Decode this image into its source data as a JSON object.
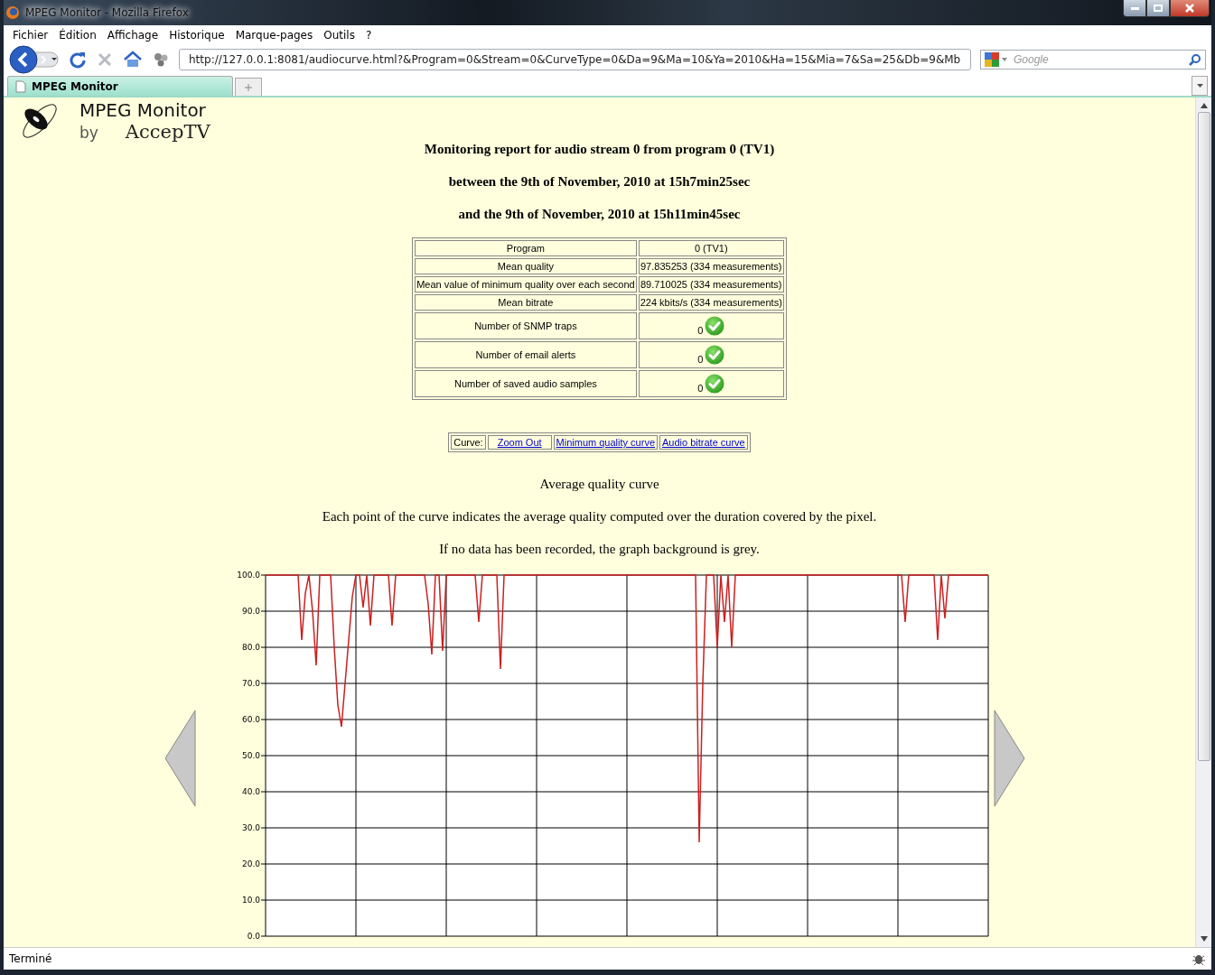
{
  "window": {
    "title": "MPEG Monitor - Mozilla Firefox"
  },
  "menu": [
    "Fichier",
    "Édition",
    "Affichage",
    "Historique",
    "Marque-pages",
    "Outils",
    "?"
  ],
  "toolbar": {
    "url": "http://127.0.0.1:8081/audiocurve.html?&Program=0&Stream=0&CurveType=0&Da=9&Ma=10&Ya=2010&Ha=15&Mia=7&Sa=25&Db=9&Mb",
    "search": {
      "placeholder": "Google"
    }
  },
  "tabs": [
    {
      "label": "MPEG Monitor",
      "selected": true
    }
  ],
  "page": {
    "logo": {
      "title": "MPEG Monitor",
      "by": "by",
      "brand": "AccepTV"
    },
    "headings": [
      "Monitoring report for audio stream 0 from program 0 (TV1)",
      "between the 9th of November, 2010 at 15h7min25sec",
      "and the 9th of November, 2010 at 15h11min45sec"
    ],
    "summary": [
      {
        "label": "Program",
        "value": "0 (TV1)",
        "kind": "text"
      },
      {
        "label": "Mean quality",
        "value": "97.835253 (334 measurements)",
        "kind": "text"
      },
      {
        "label": "Mean value of minimum quality over each second",
        "value": "89.710025 (334 measurements)",
        "kind": "text"
      },
      {
        "label": "Mean bitrate",
        "value": "224 kbits/s (334 measurements)",
        "kind": "text"
      },
      {
        "label": "Number of SNMP traps",
        "value": "0",
        "kind": "ok"
      },
      {
        "label": "Number of email alerts",
        "value": "0",
        "kind": "ok"
      },
      {
        "label": "Number of saved audio samples",
        "value": "0",
        "kind": "ok"
      }
    ],
    "curve_nav": {
      "label": "Curve:",
      "links": [
        "Zoom Out",
        "Minimum quality curve",
        "Audio bitrate curve"
      ]
    },
    "paragraphs": [
      "Average quality curve",
      "Each point of the curve indicates the average quality computed over the duration covered by the pixel.",
      "If no data has been recorded, the graph background is grey."
    ],
    "chart_data": {
      "type": "line",
      "grid": true,
      "ylim": [
        0,
        100
      ],
      "yticks": [
        {
          "value": 100,
          "label": "100.0"
        },
        {
          "value": 90,
          "label": "90.0"
        },
        {
          "value": 80,
          "label": "80.0"
        },
        {
          "value": 70,
          "label": "70.0"
        },
        {
          "value": 60,
          "label": "60.0"
        },
        {
          "value": 50,
          "label": "50.0"
        },
        {
          "value": 40,
          "label": "40.0"
        },
        {
          "value": 30,
          "label": "30.0"
        },
        {
          "value": 20,
          "label": "20.0"
        },
        {
          "value": 10,
          "label": "10.0"
        },
        {
          "value": 0,
          "label": "0.0"
        }
      ],
      "categories": [
        null,
        null,
        null,
        null,
        null,
        null,
        null,
        null,
        null,
        null,
        null,
        null,
        null,
        null,
        null,
        null,
        null,
        null,
        null,
        null,
        null,
        null,
        null,
        null,
        null,
        null,
        null,
        null,
        null,
        null,
        null,
        null,
        null,
        null,
        null,
        null,
        null,
        null,
        null,
        null,
        null,
        null,
        null,
        null,
        null,
        null,
        null,
        null,
        null,
        null,
        null,
        null,
        null,
        null,
        null,
        null,
        null,
        null,
        null,
        null,
        null,
        null,
        null,
        null,
        null,
        null,
        null,
        null,
        null,
        null,
        null,
        null,
        null,
        null,
        null,
        null,
        null,
        null,
        null,
        null,
        null,
        null,
        null,
        null,
        null,
        null,
        null,
        null,
        null,
        null,
        null,
        null,
        null,
        null,
        null,
        null,
        null,
        null,
        null,
        null,
        null,
        null,
        null,
        null,
        null,
        null,
        null,
        null,
        null,
        null,
        null,
        null,
        null,
        null,
        null,
        null,
        null,
        null,
        null,
        null,
        null,
        null,
        null,
        null,
        null,
        null,
        null,
        null,
        null,
        null,
        null,
        null,
        null,
        null,
        null,
        null,
        null,
        null,
        null,
        null,
        null,
        null,
        null,
        null,
        null,
        null,
        null,
        null,
        null,
        null,
        null,
        null,
        null,
        null,
        null,
        null,
        null,
        null,
        null,
        null,
        null,
        null,
        null,
        null,
        null,
        null,
        null,
        null,
        null,
        null,
        null,
        null,
        null,
        null,
        null,
        null,
        null,
        null,
        null,
        null,
        null,
        null,
        null,
        null,
        null,
        null,
        null,
        null,
        null,
        null,
        null,
        null,
        null,
        null,
        null,
        null,
        null,
        null,
        null,
        null,
        null
      ],
      "series": [
        {
          "color": "#cc1f1f",
          "values": [
            100,
            100,
            100,
            100,
            100,
            100,
            100,
            100,
            100,
            100,
            82,
            95,
            100,
            90,
            75,
            100,
            100,
            100,
            100,
            80,
            64,
            58,
            70,
            82,
            94,
            100,
            100,
            91,
            100,
            86,
            100,
            100,
            100,
            100,
            100,
            86,
            100,
            100,
            100,
            100,
            100,
            100,
            100,
            100,
            100,
            92,
            78,
            100,
            100,
            79,
            100,
            100,
            100,
            100,
            100,
            100,
            100,
            100,
            100,
            87,
            100,
            100,
            100,
            100,
            100,
            74,
            100,
            100,
            100,
            100,
            100,
            100,
            100,
            100,
            100,
            100,
            100,
            100,
            100,
            100,
            100,
            100,
            100,
            100,
            100,
            100,
            100,
            100,
            100,
            100,
            100,
            100,
            100,
            100,
            100,
            100,
            100,
            100,
            100,
            100,
            100,
            100,
            100,
            100,
            100,
            100,
            100,
            100,
            100,
            100,
            100,
            100,
            100,
            100,
            100,
            100,
            100,
            100,
            100,
            100,
            26,
            70,
            100,
            100,
            100,
            80,
            100,
            87,
            100,
            80,
            100,
            100,
            100,
            100,
            100,
            100,
            100,
            100,
            100,
            100,
            100,
            100,
            100,
            100,
            100,
            100,
            100,
            100,
            100,
            100,
            100,
            100,
            100,
            100,
            100,
            100,
            100,
            100,
            100,
            100,
            100,
            100,
            100,
            100,
            100,
            100,
            100,
            100,
            100,
            100,
            100,
            100,
            100,
            100,
            100,
            100,
            100,
            87,
            100,
            100,
            100,
            100,
            100,
            100,
            100,
            100,
            82,
            100,
            88,
            100,
            100,
            100,
            100,
            100,
            100,
            100,
            100,
            100,
            100,
            100,
            100
          ]
        }
      ]
    }
  },
  "status_bar": {
    "text": "Terminé"
  }
}
